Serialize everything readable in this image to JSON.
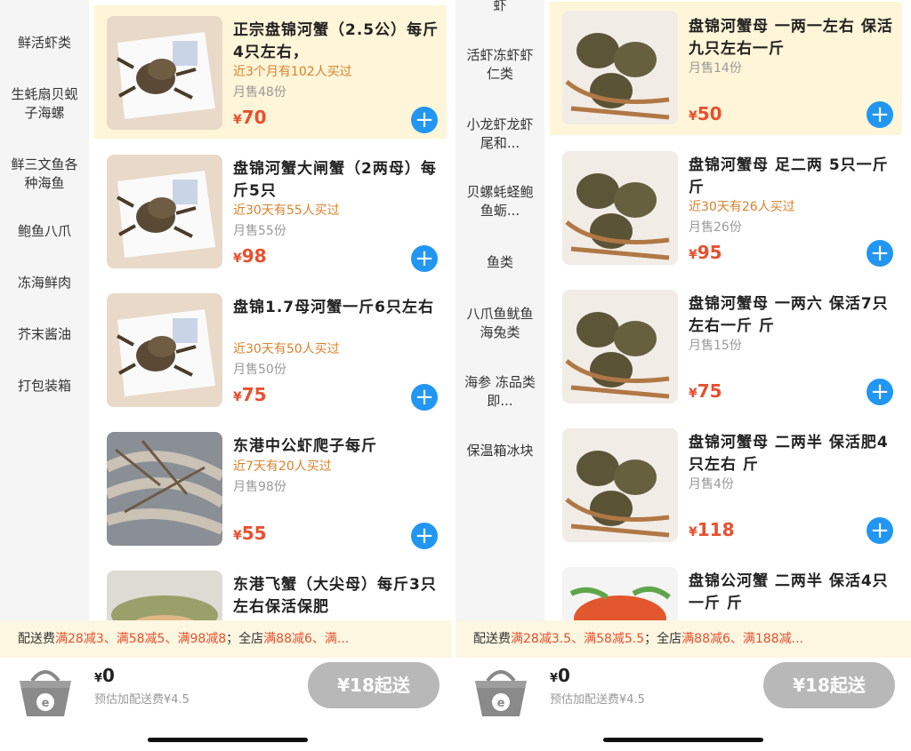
{
  "left": {
    "sidebar": [
      {
        "label": "鲜活虾类"
      },
      {
        "label": "生蚝扇贝蚬子海螺"
      },
      {
        "label": "鲜三文鱼各种海鱼"
      },
      {
        "label": "鲍鱼八爪"
      },
      {
        "label": "冻海鲜肉"
      },
      {
        "label": "芥末酱油"
      },
      {
        "label": "打包装箱"
      }
    ],
    "products": [
      {
        "name": "正宗盘锦河蟹（2.5公）每斤4只左右，",
        "bought": "近3个月有102人买过",
        "sold": "月售48份",
        "price": "70"
      },
      {
        "name": "盘锦河蟹大闸蟹（2两母）每斤5只",
        "bought": "近30天有55人买过",
        "sold": "月售55份",
        "price": "98"
      },
      {
        "name": "盘锦1.7母河蟹一斤6只左右",
        "bought": "近30天有50人买过",
        "sold": "月售50份",
        "price": "75"
      },
      {
        "name": "东港中公虾爬子每斤",
        "bought": "近7天有20人买过",
        "sold": "月售98份",
        "price": "55"
      },
      {
        "name": "东港飞蟹（大尖母）每斤3只左右保活保肥",
        "bought": "",
        "sold": "",
        "price": ""
      }
    ],
    "fee_bar": {
      "prefix": "配送费",
      "items": "满28减3、满58减5、满98减8",
      "sep": "；全店",
      "store": "满88减6、满..."
    },
    "cart": {
      "currency": "¥",
      "total": "0",
      "est_fee": "预估加配送费¥4.5",
      "min_order": "¥18起送"
    }
  },
  "right": {
    "sidebar": [
      {
        "label": "虾"
      },
      {
        "label": "活虾冻虾虾仁类"
      },
      {
        "label": "小龙虾龙虾尾和..."
      },
      {
        "label": "贝螺蚝蛏鲍鱼蛎..."
      },
      {
        "label": "鱼类"
      },
      {
        "label": "八爪鱼鱿鱼海兔类"
      },
      {
        "label": "海参 冻品类即..."
      },
      {
        "label": "保温箱冰块"
      }
    ],
    "products": [
      {
        "name": "盘锦河蟹母 一两一左右 保活九只左右一斤",
        "bought": "",
        "sold": "月售14份",
        "price": "50"
      },
      {
        "name": "盘锦河蟹母 足二两 5只一斤 斤",
        "bought": "近30天有26人买过",
        "sold": "月售26份",
        "price": "95"
      },
      {
        "name": "盘锦河蟹母 一两六 保活7只左右一斤 斤",
        "bought": "",
        "sold": "月售15份",
        "price": "75"
      },
      {
        "name": "盘锦河蟹母 二两半 保活肥4只左右 斤",
        "bought": "",
        "sold": "月售4份",
        "price": "118"
      },
      {
        "name": "盘锦公河蟹 二两半 保活4只一斤 斤",
        "bought": "",
        "sold": "",
        "price": ""
      }
    ],
    "fee_bar": {
      "prefix": "配送费",
      "items": "满28减3.5、满58减5.5",
      "sep": "；全店",
      "store": "满88减6、满188减..."
    },
    "cart": {
      "currency": "¥",
      "total": "0",
      "est_fee": "预估加配送费¥4.5",
      "min_order": "¥18起送"
    }
  },
  "colors": {
    "accent_blue": "#2196f3",
    "price_red": "#e8502f",
    "bought_orange": "#d9822b",
    "highlight": "#fff5d8"
  },
  "icons": {
    "add": "plus-icon",
    "cart": "basket-icon"
  }
}
